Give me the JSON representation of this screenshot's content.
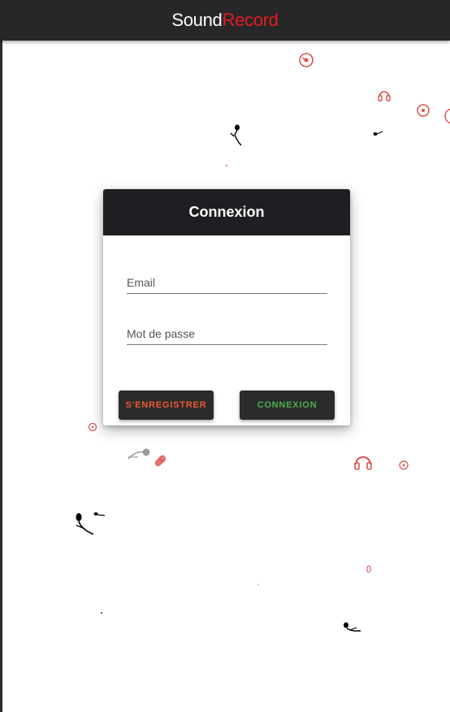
{
  "app": {
    "brand_part1": "Sound",
    "brand_part2": "Record"
  },
  "login": {
    "title": "Connexion",
    "email_placeholder": "Email",
    "password_placeholder": "Mot de passe",
    "register_label": "S'ENREGISTRER",
    "login_label": "CONNEXION"
  },
  "colors": {
    "appbar": "#272727",
    "brand_accent": "#e31b23",
    "register_text": "#ef5a2f",
    "login_text": "#4caf50"
  },
  "decor_icons": [
    "vinyl-icon",
    "headphones-icon",
    "microphone-icon",
    "music-note-icon"
  ]
}
